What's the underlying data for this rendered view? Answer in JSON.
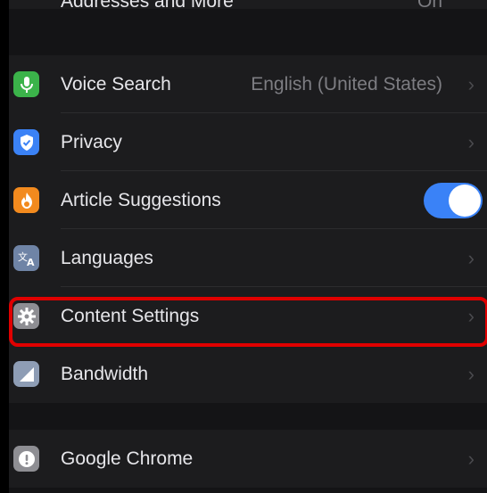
{
  "top_row": {
    "label": "Addresses and More",
    "value": "On"
  },
  "section1": [
    {
      "label": "Voice Search",
      "value": "English (United States)",
      "icon": "microphone-icon",
      "icon_color": "#3bb34a",
      "chevron": "›"
    },
    {
      "label": "Privacy",
      "icon": "shield-icon",
      "icon_color": "#3b82f6",
      "chevron": "›"
    },
    {
      "label": "Article Suggestions",
      "icon": "flame-icon",
      "icon_color": "#f28a1e",
      "toggle_on": true
    },
    {
      "label": "Languages",
      "icon": "translate-icon",
      "icon_color": "#6f84a6",
      "chevron": "›"
    },
    {
      "label": "Content Settings",
      "icon": "gear-icon",
      "icon_color": "#8e8e93",
      "chevron": "›"
    },
    {
      "label": "Bandwidth",
      "icon": "bandwidth-icon",
      "icon_color": "#8e9db5",
      "chevron": "›"
    }
  ],
  "section2": [
    {
      "label": "Google Chrome",
      "icon": "info-icon",
      "icon_color": "#8e8e93",
      "chevron": "›"
    }
  ],
  "colors": {
    "highlight": "#e00000",
    "toggle_on": "#3a82f7",
    "background": "#1c1c1e"
  }
}
